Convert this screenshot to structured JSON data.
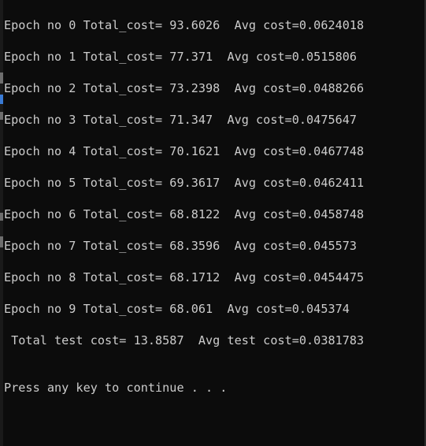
{
  "console": {
    "lines": [
      "Epoch no 0 Total_cost= 93.6026  Avg cost=0.0624018",
      "Epoch no 1 Total_cost= 77.371  Avg cost=0.0515806",
      "Epoch no 2 Total_cost= 73.2398  Avg cost=0.0488266",
      "Epoch no 3 Total_cost= 71.347  Avg cost=0.0475647",
      "Epoch no 4 Total_cost= 70.1621  Avg cost=0.0467748",
      "Epoch no 5 Total_cost= 69.3617  Avg cost=0.0462411",
      "Epoch no 6 Total_cost= 68.8122  Avg cost=0.0458748",
      "Epoch no 7 Total_cost= 68.3596  Avg cost=0.045573",
      "Epoch no 8 Total_cost= 68.1712  Avg cost=0.0454475",
      "Epoch no 9 Total_cost= 68.061  Avg cost=0.045374",
      " Total test cost= 13.8587  Avg test cost=0.0381783",
      "Press any key to continue . . ."
    ]
  },
  "colors": {
    "background": "#0c0c0c",
    "text": "#cccccc"
  }
}
